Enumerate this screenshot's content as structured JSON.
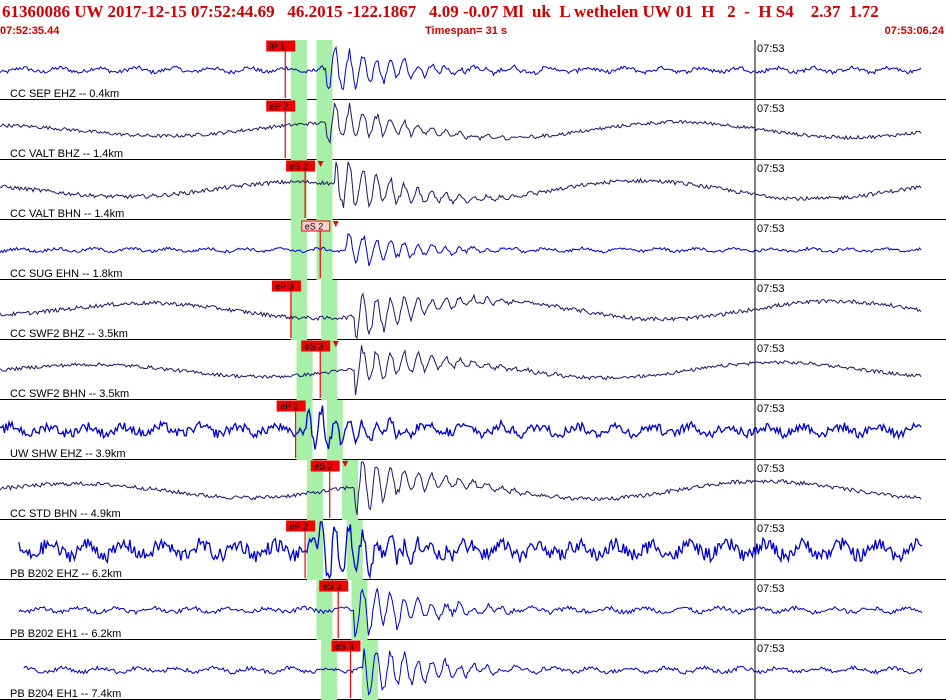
{
  "header": {
    "title": "61360086 UW 2017-12-15 07:52:44.69   46.2015 -122.1867   4.09 -0.07 Ml  uk  L wethelen UW 01  H   2  -  H S4    2.37  1.72",
    "start_time": "07:52:35.44",
    "timespan_label": "Timespan=  31 s",
    "end_time": "07:53:06.24"
  },
  "colors": {
    "header_text": "#cc0000",
    "pick": "#ee0000",
    "window": "#a8f0a8",
    "trace_blue": "#0000cc",
    "trace_navy": "#1a1a66"
  },
  "minute_label": "07:53",
  "traces": [
    {
      "label": "CC SEP EHZ -- 0.4km",
      "pick": "iP 1",
      "pick_time": 0.301,
      "win_time": 0.316,
      "second_time": 0.343,
      "color": "blue",
      "amp": 0.35,
      "kind": "noise",
      "arr": 0.35
    },
    {
      "label": "CC VALT BHZ -- 1.4km",
      "pick": "eP 2",
      "pick_time": 0.301,
      "win_time": 0.316,
      "second_time": 0.343,
      "color": "navy",
      "amp": 0.3,
      "kind": "long",
      "arr": 0.35
    },
    {
      "label": "CC VALT BHN -- 1.4km",
      "pick": "eS 2",
      "pick_time": 0.322,
      "win_time": 0.316,
      "second_time": 0.343,
      "color": "navy",
      "amp": 0.35,
      "kind": "long",
      "arr": 0.36,
      "marker": true
    },
    {
      "label": "CC SUG EHN -- 1.8km",
      "pick": "eS 2",
      "pick_time": 0.338,
      "win_time": 0.316,
      "second_time": 0.343,
      "color": "blue",
      "amp": 0.25,
      "kind": "noise",
      "arr": 0.37,
      "marker": true,
      "pale": true
    },
    {
      "label": "CC SWF2 BHZ -- 3.5km",
      "pick": "eP 3",
      "pick_time": 0.307,
      "win_time": 0.316,
      "second_time": 0.348,
      "color": "navy",
      "amp": 0.35,
      "kind": "long",
      "arr": 0.38
    },
    {
      "label": "CC SWF2 BHN -- 3.5km",
      "pick": "eS 3",
      "pick_time": 0.338,
      "win_time": 0.322,
      "second_time": 0.348,
      "color": "navy",
      "amp": 0.3,
      "kind": "long",
      "arr": 0.38,
      "marker": true
    },
    {
      "label": "UW SHW EHZ -- 3.9km",
      "pick": "eP 2",
      "pick_time": 0.312,
      "win_time": 0.322,
      "second_time": 0.354,
      "color": "blue",
      "amp": 0.3,
      "kind": "noise",
      "arr": 0.33,
      "heavy": true
    },
    {
      "label": "CC STD BHN -- 4.9km",
      "pick": "eS 2",
      "pick_time": 0.348,
      "win_time": 0.333,
      "second_time": 0.37,
      "color": "navy",
      "amp": 0.35,
      "kind": "long",
      "arr": 0.38,
      "marker": true
    },
    {
      "label": "PB B202 EHZ -- 6.2km",
      "pick": "eP 2",
      "pick_time": 0.322,
      "win_time": 0.333,
      "second_time": 0.375,
      "color": "blue",
      "amp": 0.45,
      "kind": "noise",
      "arr": 0.34,
      "heavy": true,
      "start": 0.02
    },
    {
      "label": "PB B202 EH1 -- 6.2km",
      "pick": "eS 3",
      "pick_time": 0.357,
      "win_time": 0.343,
      "second_time": 0.38,
      "color": "blue",
      "amp": 0.35,
      "kind": "noise",
      "arr": 0.38,
      "start": 0.02
    },
    {
      "label": "PB B204 EH1 -- 7.4km",
      "pick": "eS 3",
      "pick_time": 0.37,
      "win_time": 0.348,
      "second_time": 0.391,
      "color": "blue",
      "amp": 0.35,
      "kind": "noise",
      "arr": 0.39,
      "start": 0.025
    }
  ]
}
